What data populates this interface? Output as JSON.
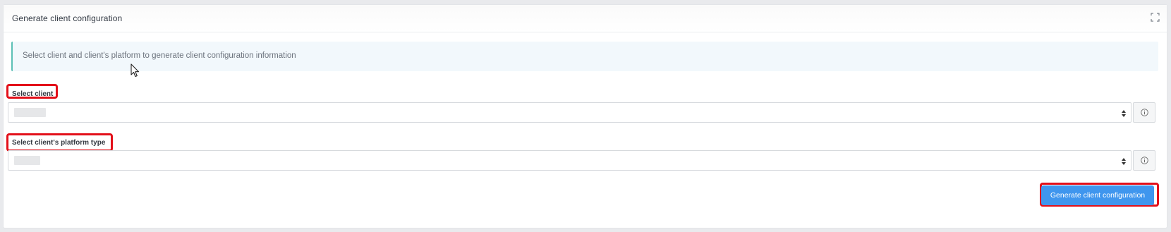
{
  "panel": {
    "title": "Generate client configuration",
    "fullscreen_icon": "expand-icon"
  },
  "alert": {
    "text": "Select client and client's platform to generate client configuration information"
  },
  "fields": {
    "client": {
      "label": "Select client",
      "value": "",
      "info_icon": "info-circle-icon"
    },
    "platform": {
      "label": "Select client's platform type",
      "value": "",
      "info_icon": "info-circle-icon"
    }
  },
  "actions": {
    "generate_label": "Generate client configuration"
  },
  "colors": {
    "primary_button": "#3f96ee",
    "highlight_outline": "#e3101a",
    "alert_accent": "#5bbfb5",
    "alert_background": "#f2f8fc"
  }
}
